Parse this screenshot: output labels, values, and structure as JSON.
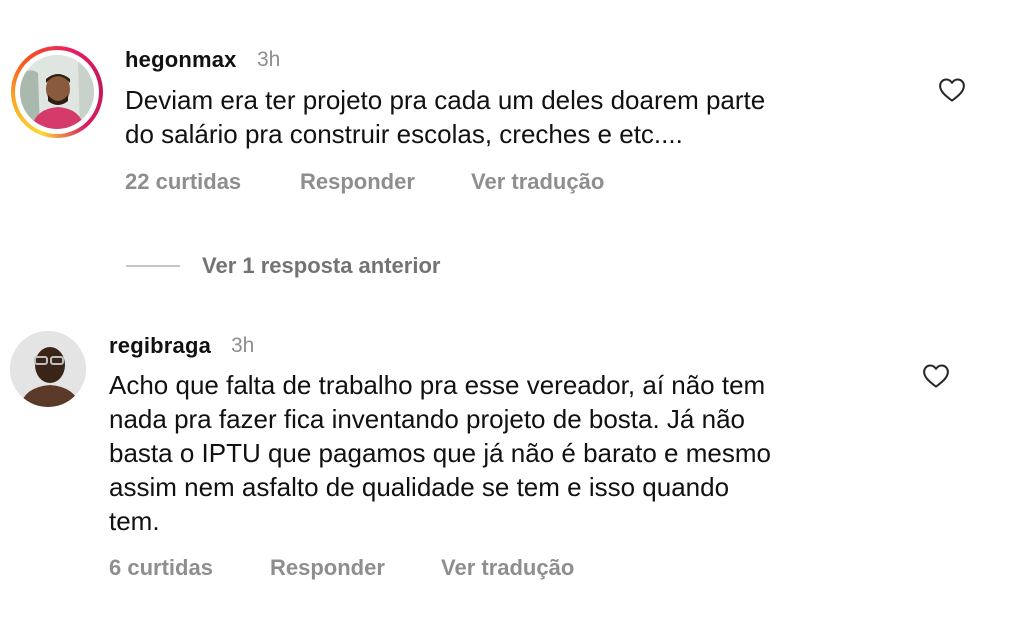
{
  "comments": [
    {
      "username": "hegonmax",
      "time": "3h",
      "text": "Deviam era ter projeto pra cada um deles doarem parte\ndo salário pra construir escolas, creches e etc....",
      "likes": "22 curtidas",
      "reply_label": "Responder",
      "translate_label": "Ver tradução"
    },
    {
      "username": "regibraga",
      "time": "3h",
      "text": "Acho que falta de trabalho pra esse vereador, aí não tem\nnada pra fazer fica inventando projeto de bosta. Já não\nbasta o IPTU que pagamos que já não é barato e mesmo\nassim nem asfalto de qualidade se tem e isso quando\ntem.",
      "likes": "6 curtidas",
      "reply_label": "Responder",
      "translate_label": "Ver tradução"
    }
  ],
  "view_replies": "Ver 1 resposta anterior",
  "icons": {
    "like": "heart-icon"
  },
  "colors": {
    "muted": "#8e8e8e",
    "text": "#111111",
    "story_ring": [
      "#fdd835",
      "#f4511e",
      "#e91e63"
    ]
  }
}
